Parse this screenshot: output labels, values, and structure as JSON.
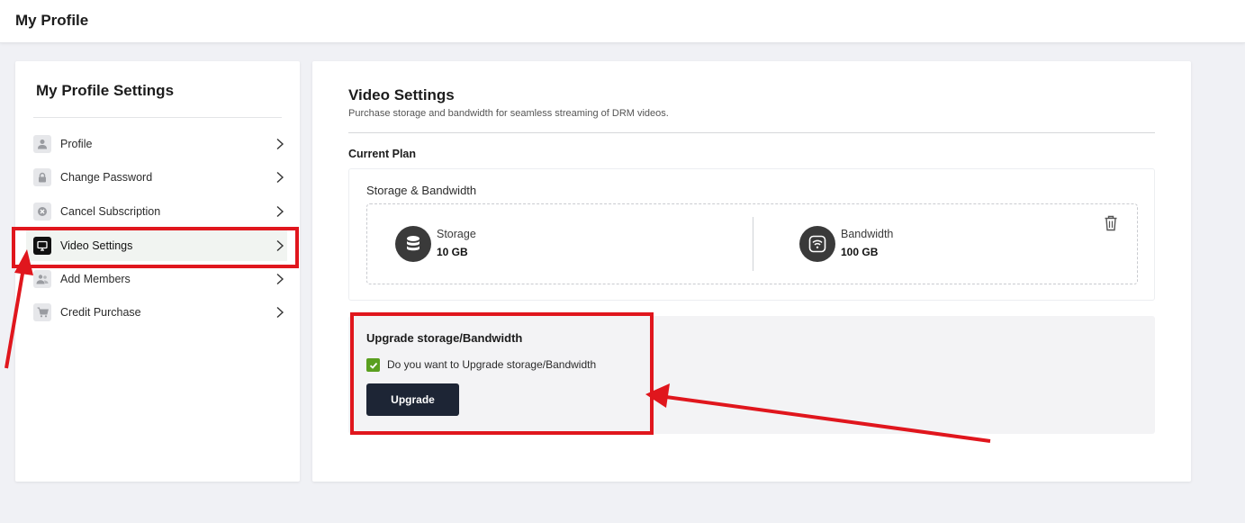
{
  "header": {
    "title": "My Profile"
  },
  "sidebar": {
    "title": "My Profile Settings",
    "items": [
      {
        "label": "Profile",
        "icon": "user-icon"
      },
      {
        "label": "Change Password",
        "icon": "lock-icon"
      },
      {
        "label": "Cancel Subscription",
        "icon": "cancel-circle-icon"
      },
      {
        "label": "Video Settings",
        "icon": "monitor-icon",
        "active": true
      },
      {
        "label": "Add Members",
        "icon": "users-icon"
      },
      {
        "label": "Credit Purchase",
        "icon": "cart-icon"
      }
    ]
  },
  "main": {
    "title": "Video Settings",
    "subtitle": "Purchase storage and bandwidth for seamless streaming of DRM videos.",
    "current_plan_label": "Current Plan",
    "plan": {
      "label": "Storage & Bandwidth",
      "storage": {
        "label": "Storage",
        "value": "10 GB",
        "icon": "database-icon"
      },
      "bandwidth": {
        "label": "Bandwidth",
        "value": "100 GB",
        "icon": "wifi-icon"
      },
      "delete_icon": "trash-icon"
    },
    "upgrade": {
      "title": "Upgrade storage/Bandwidth",
      "checkbox_label": "Do you want to Upgrade storage/Bandwidth",
      "checkbox_checked": true,
      "button_label": "Upgrade"
    }
  },
  "colors": {
    "annotation": "#e0161d",
    "button_bg": "#1d2535",
    "checkbox": "#5a9f1f",
    "page_bg": "#f0f1f5"
  }
}
